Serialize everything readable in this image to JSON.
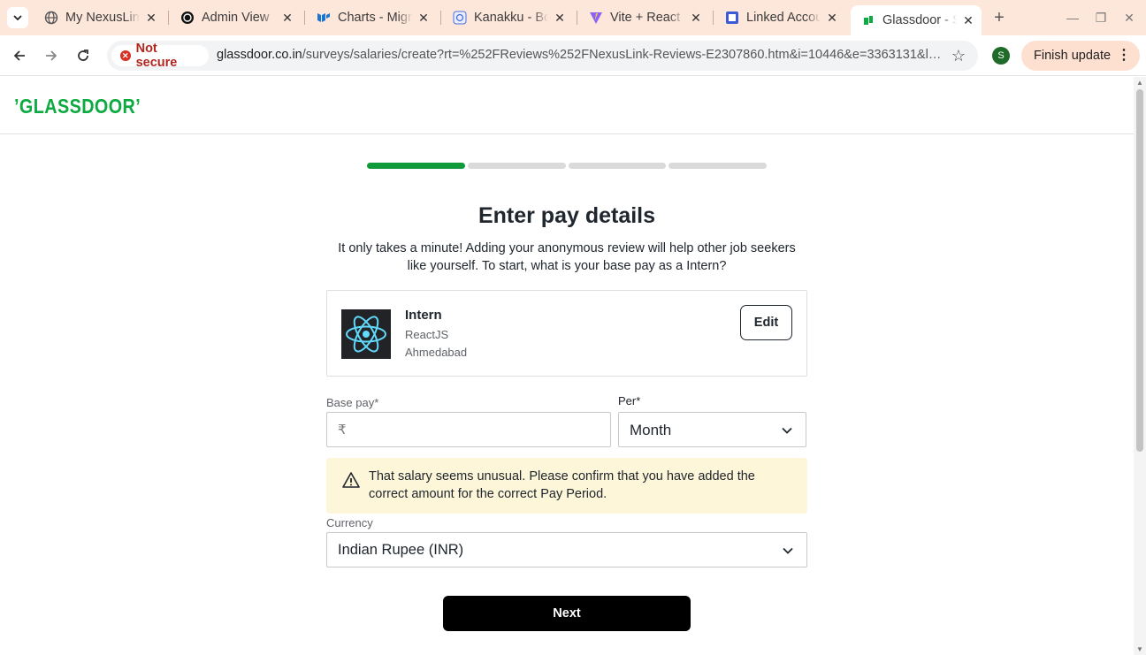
{
  "browser": {
    "tabs": [
      {
        "title": "My NexusLink",
        "icon": "globe-icon"
      },
      {
        "title": "Admin View",
        "icon": "openai-icon"
      },
      {
        "title": "Charts - Migrate",
        "icon": "mui-icon"
      },
      {
        "title": "Kanakku - Bootstrap",
        "icon": "kanakku-icon"
      },
      {
        "title": "Vite + React",
        "icon": "vite-icon"
      },
      {
        "title": "Linked Accounts",
        "icon": "linked-accounts-icon"
      },
      {
        "title": "Glassdoor - Salaries",
        "icon": "glassdoor-icon",
        "active": true
      }
    ],
    "security_label": "Not secure",
    "url_host": "glassdoor.co.in",
    "url_path": "/surveys/salaries/create?rt=%252FReviews%252FNexusLink-Reviews-E2307860.htm&i=10446&e=3363131&locI...",
    "profile_initial": "S",
    "finish_update_label": "Finish update"
  },
  "site": {
    "logo": "GLASSDOOR"
  },
  "progress": {
    "steps_total": 4,
    "steps_done": 1
  },
  "form": {
    "heading": "Enter pay details",
    "intro_line1": "It only takes a minute! Adding your anonymous review will help other job seekers",
    "intro_line2": "like yourself. To start, what is your base pay as a Intern?",
    "job": {
      "title": "Intern",
      "skill": "ReactJS",
      "location": "Ahmedabad",
      "edit_label": "Edit",
      "logo_icon": "react-icon"
    },
    "base_pay": {
      "label": "Base pay*",
      "currency_symbol": "₹",
      "value": ""
    },
    "per": {
      "label": "Per*",
      "selected": "Month"
    },
    "warning": {
      "line1": "That salary seems unusual. Please confirm that you have added the",
      "line2": "correct amount for the correct Pay Period."
    },
    "currency": {
      "label": "Currency",
      "selected": "Indian Rupee (INR)"
    },
    "next_label": "Next"
  },
  "colors": {
    "brand_green": "#0caa41",
    "progress_green": "#0f9b3c",
    "warning_bg": "#fdf6d8",
    "tabbar_bg": "#fde6da"
  }
}
